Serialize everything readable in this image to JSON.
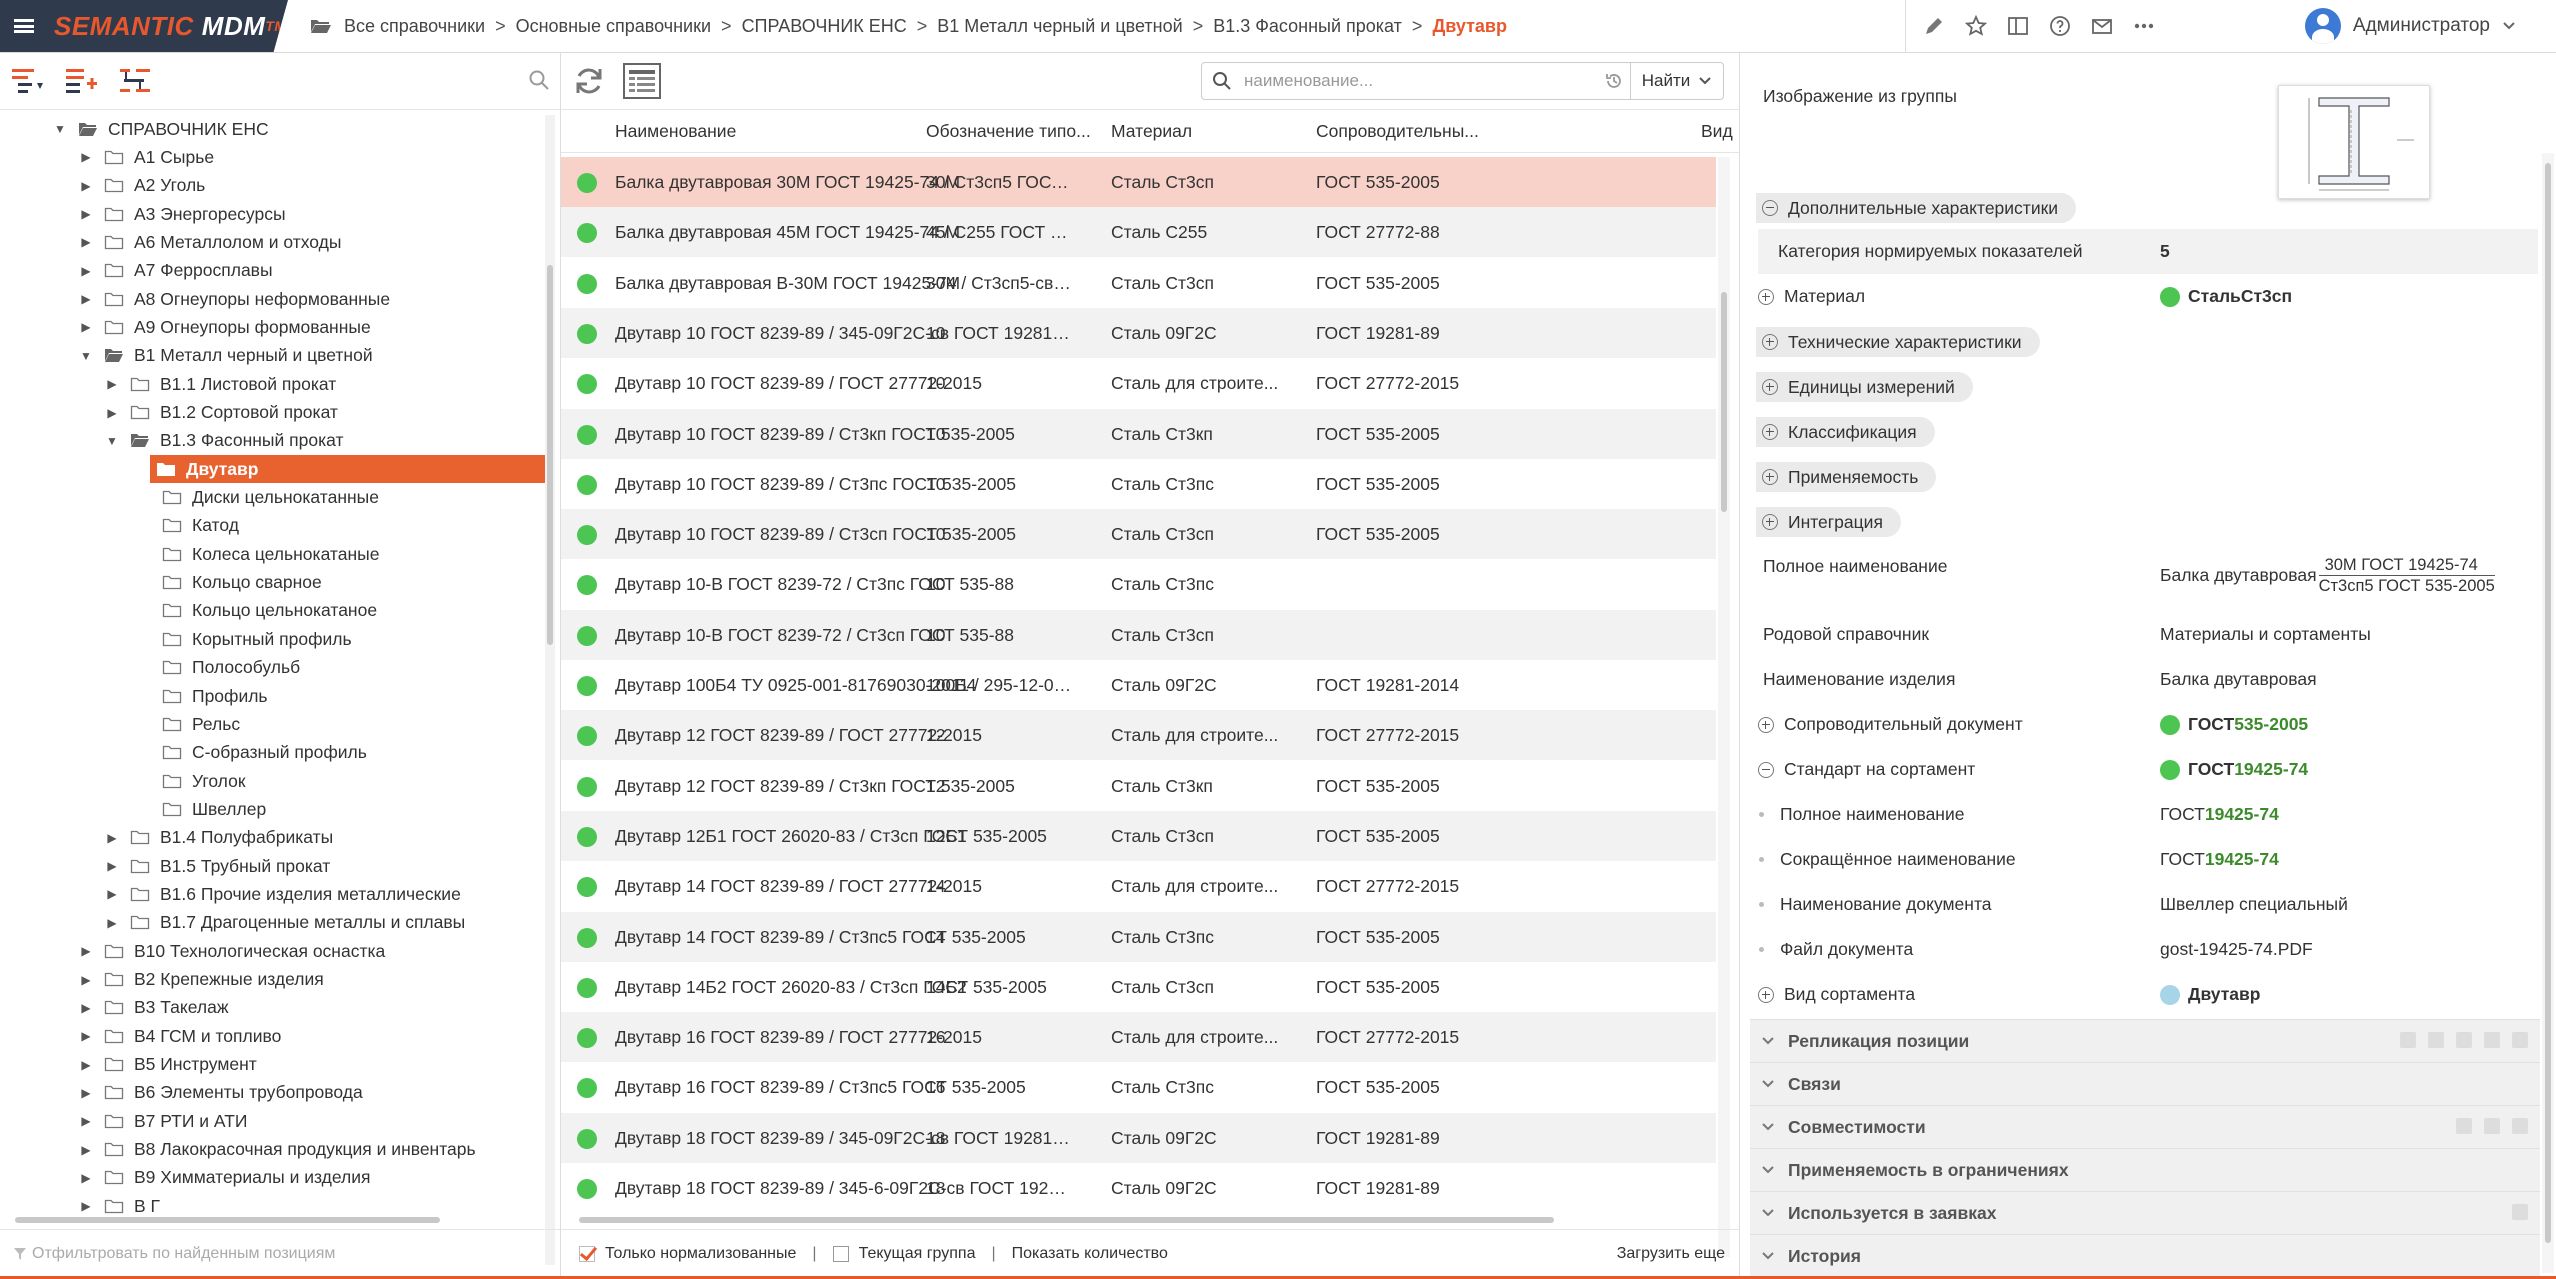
{
  "app": {
    "logo_main": "SEMANTIC",
    "logo_sub": "MDM",
    "logo_tm": "TM"
  },
  "breadcrumb": {
    "items": [
      "Все справочники",
      "Основные справочники",
      "СПРАВОЧНИК ЕНС",
      "В1 Металл черный и цветной",
      "В1.3 Фасонный прокат"
    ],
    "current": "Двутавр",
    "separator": ">"
  },
  "user": {
    "name": "Администратор"
  },
  "tree": {
    "nodes": [
      {
        "label": "СПРАВОЧНИК ЕНС",
        "level": 0,
        "arrow": "▼",
        "open": true
      },
      {
        "label": "А1 Сырье",
        "level": 1,
        "arrow": "▶"
      },
      {
        "label": "А2 Уголь",
        "level": 1,
        "arrow": "▶"
      },
      {
        "label": "А3 Энергоресурсы",
        "level": 1,
        "arrow": "▶"
      },
      {
        "label": "А6 Металлолом и отходы",
        "level": 1,
        "arrow": "▶"
      },
      {
        "label": "А7 Ферросплавы",
        "level": 1,
        "arrow": "▶"
      },
      {
        "label": "А8 Огнеупоры неформованные",
        "level": 1,
        "arrow": "▶"
      },
      {
        "label": "А9 Огнеупоры формованные",
        "level": 1,
        "arrow": "▶"
      },
      {
        "label": "В1 Металл черный и цветной",
        "level": 1,
        "arrow": "▼",
        "open": true
      },
      {
        "label": "В1.1 Листовой прокат",
        "level": 2,
        "arrow": "▶"
      },
      {
        "label": "В1.2 Сортовой прокат",
        "level": 2,
        "arrow": "▶"
      },
      {
        "label": "В1.3 Фасонный прокат",
        "level": 2,
        "arrow": "▼",
        "open": true
      },
      {
        "label": "Двутавр",
        "level": 3,
        "arrow": "",
        "selected": true
      },
      {
        "label": "Диски цельнокатанные",
        "level": 3,
        "arrow": ""
      },
      {
        "label": "Катод",
        "level": 3,
        "arrow": ""
      },
      {
        "label": "Колеса цельнокатаные",
        "level": 3,
        "arrow": ""
      },
      {
        "label": "Кольцо сварное",
        "level": 3,
        "arrow": ""
      },
      {
        "label": "Кольцо цельнокатаное",
        "level": 3,
        "arrow": ""
      },
      {
        "label": "Корытный профиль",
        "level": 3,
        "arrow": ""
      },
      {
        "label": "Полособульб",
        "level": 3,
        "arrow": ""
      },
      {
        "label": "Профиль",
        "level": 3,
        "arrow": ""
      },
      {
        "label": "Рельс",
        "level": 3,
        "arrow": ""
      },
      {
        "label": "С-образный профиль",
        "level": 3,
        "arrow": ""
      },
      {
        "label": "Уголок",
        "level": 3,
        "arrow": ""
      },
      {
        "label": "Швеллер",
        "level": 3,
        "arrow": ""
      },
      {
        "label": "В1.4 Полуфабрикаты",
        "level": 2,
        "arrow": "▶"
      },
      {
        "label": "В1.5 Трубный прокат",
        "level": 2,
        "arrow": "▶"
      },
      {
        "label": "В1.6 Прочие изделия металлические",
        "level": 2,
        "arrow": "▶"
      },
      {
        "label": "В1.7 Драгоценные металлы и сплавы",
        "level": 2,
        "arrow": "▶"
      },
      {
        "label": "В10 Технологическая оснастка",
        "level": 1,
        "arrow": "▶"
      },
      {
        "label": "В2 Крепежные изделия",
        "level": 1,
        "arrow": "▶"
      },
      {
        "label": "В3 Такелаж",
        "level": 1,
        "arrow": "▶"
      },
      {
        "label": "В4 ГСМ и топливо",
        "level": 1,
        "arrow": "▶"
      },
      {
        "label": "В5 Инструмент",
        "level": 1,
        "arrow": "▶"
      },
      {
        "label": "В6 Элементы трубопровода",
        "level": 1,
        "arrow": "▶"
      },
      {
        "label": "В7 РТИ и АТИ",
        "level": 1,
        "arrow": "▶"
      },
      {
        "label": "В8 Лакокрасочная продукция и инвентарь",
        "level": 1,
        "arrow": "▶"
      },
      {
        "label": "В9 Химматериалы и изделия",
        "level": 1,
        "arrow": "▶"
      },
      {
        "label": "В Г",
        "level": 1,
        "arrow": "▶"
      }
    ],
    "filter_placeholder": "Отфильтровать по найденным позициям"
  },
  "grid": {
    "search_placeholder": "наименование...",
    "search_value": "",
    "find_label": "Найти",
    "columns": [
      "Наименование",
      "Обозначение типо...",
      "Материал",
      "Сопроводительны...",
      "Вид"
    ],
    "rows": [
      [
        "Балка двутавровая 30М ГОСТ 19425-74 / Ст3сп5 ГОСТ ...",
        "30М",
        "Сталь Ст3сп",
        "ГОСТ 535-2005"
      ],
      [
        "Балка двутавровая 45М ГОСТ 19425-74 / С255 ГОСТ 27...",
        "45М",
        "Сталь С255",
        "ГОСТ 27772-88"
      ],
      [
        "Балка двутавровая В-30М ГОСТ 19425-74 / Ст3сп5-св Г...",
        "30М",
        "Сталь Ст3сп",
        "ГОСТ 535-2005"
      ],
      [
        "Двутавр 10 ГОСТ 8239-89 / 345-09Г2С-св ГОСТ 19281-89",
        "10",
        "Сталь 09Г2С",
        "ГОСТ 19281-89"
      ],
      [
        "Двутавр 10 ГОСТ 8239-89 / ГОСТ 27772-2015",
        "10",
        "Сталь для строите...",
        "ГОСТ 27772-2015"
      ],
      [
        "Двутавр 10 ГОСТ 8239-89 / Ст3кп ГОСТ 535-2005",
        "10",
        "Сталь Ст3кп",
        "ГОСТ 535-2005"
      ],
      [
        "Двутавр 10 ГОСТ 8239-89 / Ст3пс ГОСТ 535-2005",
        "10",
        "Сталь Ст3пс",
        "ГОСТ 535-2005"
      ],
      [
        "Двутавр 10 ГОСТ 8239-89 / Ст3сп ГОСТ 535-2005",
        "10",
        "Сталь Ст3сп",
        "ГОСТ 535-2005"
      ],
      [
        "Двутавр 10-В ГОСТ 8239-72 / Ст3пс ГОСТ 535-88",
        "10",
        "Сталь Ст3пс",
        ""
      ],
      [
        "Двутавр 10-В ГОСТ 8239-72 / Ст3сп ГОСТ 535-88",
        "10",
        "Сталь Ст3сп",
        ""
      ],
      [
        "Двутавр 100Б4 ТУ 0925-001-81769030-2011 / 295-12-09Г...",
        "100Б4",
        "Сталь 09Г2С",
        "ГОСТ 19281-2014"
      ],
      [
        "Двутавр 12 ГОСТ 8239-89 / ГОСТ 27772-2015",
        "12",
        "Сталь для строите...",
        "ГОСТ 27772-2015"
      ],
      [
        "Двутавр 12 ГОСТ 8239-89 / Ст3кп ГОСТ 535-2005",
        "12",
        "Сталь Ст3кп",
        "ГОСТ 535-2005"
      ],
      [
        "Двутавр 12Б1 ГОСТ 26020-83 / Ст3сп ГОСТ 535-2005",
        "12Б1",
        "Сталь Ст3сп",
        "ГОСТ 535-2005"
      ],
      [
        "Двутавр 14 ГОСТ 8239-89 / ГОСТ 27772-2015",
        "14",
        "Сталь для строите...",
        "ГОСТ 27772-2015"
      ],
      [
        "Двутавр 14 ГОСТ 8239-89 / Ст3пс5 ГОСТ 535-2005",
        "14",
        "Сталь Ст3пс",
        "ГОСТ 535-2005"
      ],
      [
        "Двутавр 14Б2 ГОСТ 26020-83 / Ст3сп ГОСТ 535-2005",
        "14Б2",
        "Сталь Ст3сп",
        "ГОСТ 535-2005"
      ],
      [
        "Двутавр 16 ГОСТ 8239-89 / ГОСТ 27772-2015",
        "16",
        "Сталь для строите...",
        "ГОСТ 27772-2015"
      ],
      [
        "Двутавр 16 ГОСТ 8239-89 / Ст3пс5 ГОСТ 535-2005",
        "16",
        "Сталь Ст3пс",
        "ГОСТ 535-2005"
      ],
      [
        "Двутавр 18 ГОСТ 8239-89 / 345-09Г2С-св ГОСТ 19281-89",
        "18",
        "Сталь 09Г2С",
        "ГОСТ 19281-89"
      ],
      [
        "Двутавр 18 ГОСТ 8239-89 / 345-6-09Г2С-св ГОСТ 19281-...",
        "18",
        "Сталь 09Г2С",
        "ГОСТ 19281-89"
      ]
    ],
    "footer": {
      "only_normalized": "Только нормализованные",
      "current_group": "Текущая группа",
      "show_count": "Показать количество",
      "load_more": "Загрузить еще",
      "separator": "|"
    }
  },
  "detail": {
    "image_label": "Изображение из группы",
    "extra_chars": "Дополнительные характеристики",
    "category_label": "Категория нормируемых показателей",
    "category_value": "5",
    "material_label": "Материал",
    "material_prefix": "Сталь ",
    "material_value": "Ст3сп",
    "tech_chars": "Технические характеристики",
    "units": "Единицы измерений",
    "classification": "Классификация",
    "applicability": "Применяемость",
    "integration": "Интеграция",
    "full_name_label": "Полное наименование",
    "full_name_prefix": "Балка двутавровая",
    "full_name_num": "30М ГОСТ 19425-74",
    "full_name_den": "Ст3сп5 ГОСТ 535-2005",
    "parent_ref_label": "Родовой справочник",
    "parent_ref_value": "Материалы и сортаменты",
    "product_name_label": "Наименование изделия",
    "product_name_value": "Балка двутавровая",
    "accomp_doc_label": "Сопроводительный документ",
    "accomp_doc_prefix": "ГОСТ ",
    "accomp_doc_value": "535-2005",
    "standard_label": "Стандарт на сортамент",
    "standard_prefix": "ГОСТ ",
    "standard_value": "19425-74",
    "std_full_label": "Полное наименование",
    "std_full_prefix": "ГОСТ ",
    "std_full_value": "19425-74",
    "std_short_label": "Сокращённое наименование",
    "std_short_prefix": "ГОСТ ",
    "std_short_value": "19425-74",
    "doc_name_label": "Наименование документа",
    "doc_name_value": "Швеллер специальный",
    "doc_file_label": "Файл документа",
    "doc_file_value": "gost-19425-74.PDF",
    "assort_label": "Вид сортамента",
    "assort_value": "Двутавр",
    "sections": [
      "Репликация позиции",
      "Связи",
      "Совместимости",
      "Применяемость в ограничениях",
      "Используется в заявках",
      "История"
    ]
  },
  "colors": {
    "accent": "#e8582c",
    "selected_row": "#f8d2c8",
    "status_green": "#4cc552",
    "topbar_dark": "#2f3b4c",
    "link": "#3d7ac4"
  }
}
